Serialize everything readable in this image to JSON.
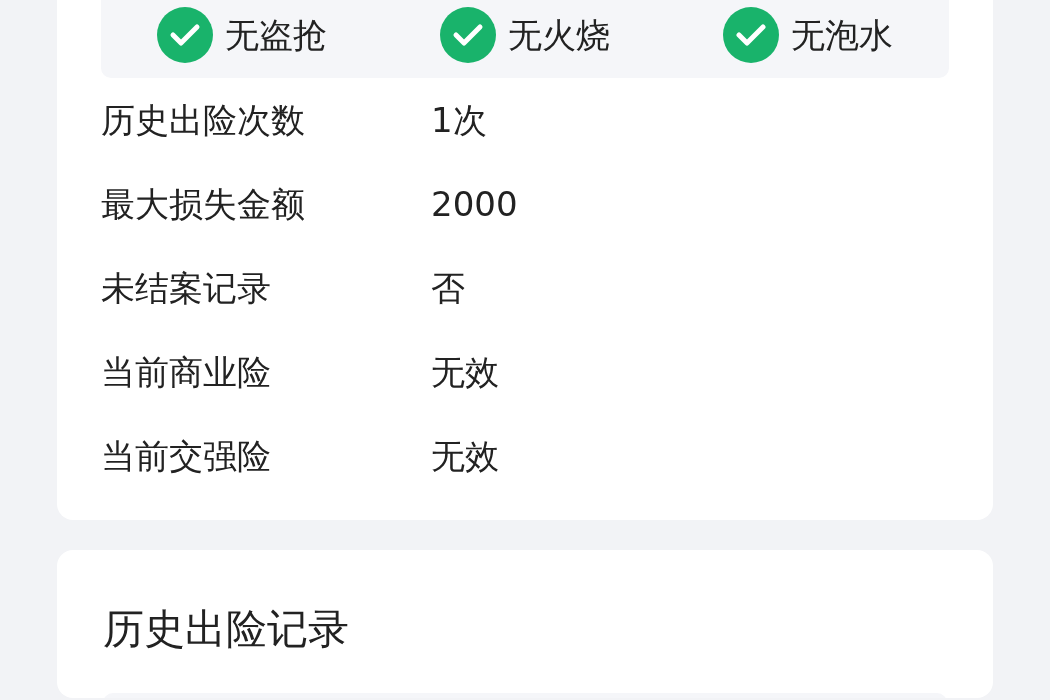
{
  "checks": [
    {
      "label": "无盗抢",
      "checked": true
    },
    {
      "label": "无火烧",
      "checked": true
    },
    {
      "label": "无泡水",
      "checked": true
    }
  ],
  "details": [
    {
      "label": "历史出险次数",
      "value": "1次"
    },
    {
      "label": "最大损失金额",
      "value": "2000"
    },
    {
      "label": "未结案记录",
      "value": "否"
    },
    {
      "label": "当前商业险",
      "value": "无效"
    },
    {
      "label": "当前交强险",
      "value": "无效"
    }
  ],
  "history": {
    "title": "历史出险记录"
  }
}
